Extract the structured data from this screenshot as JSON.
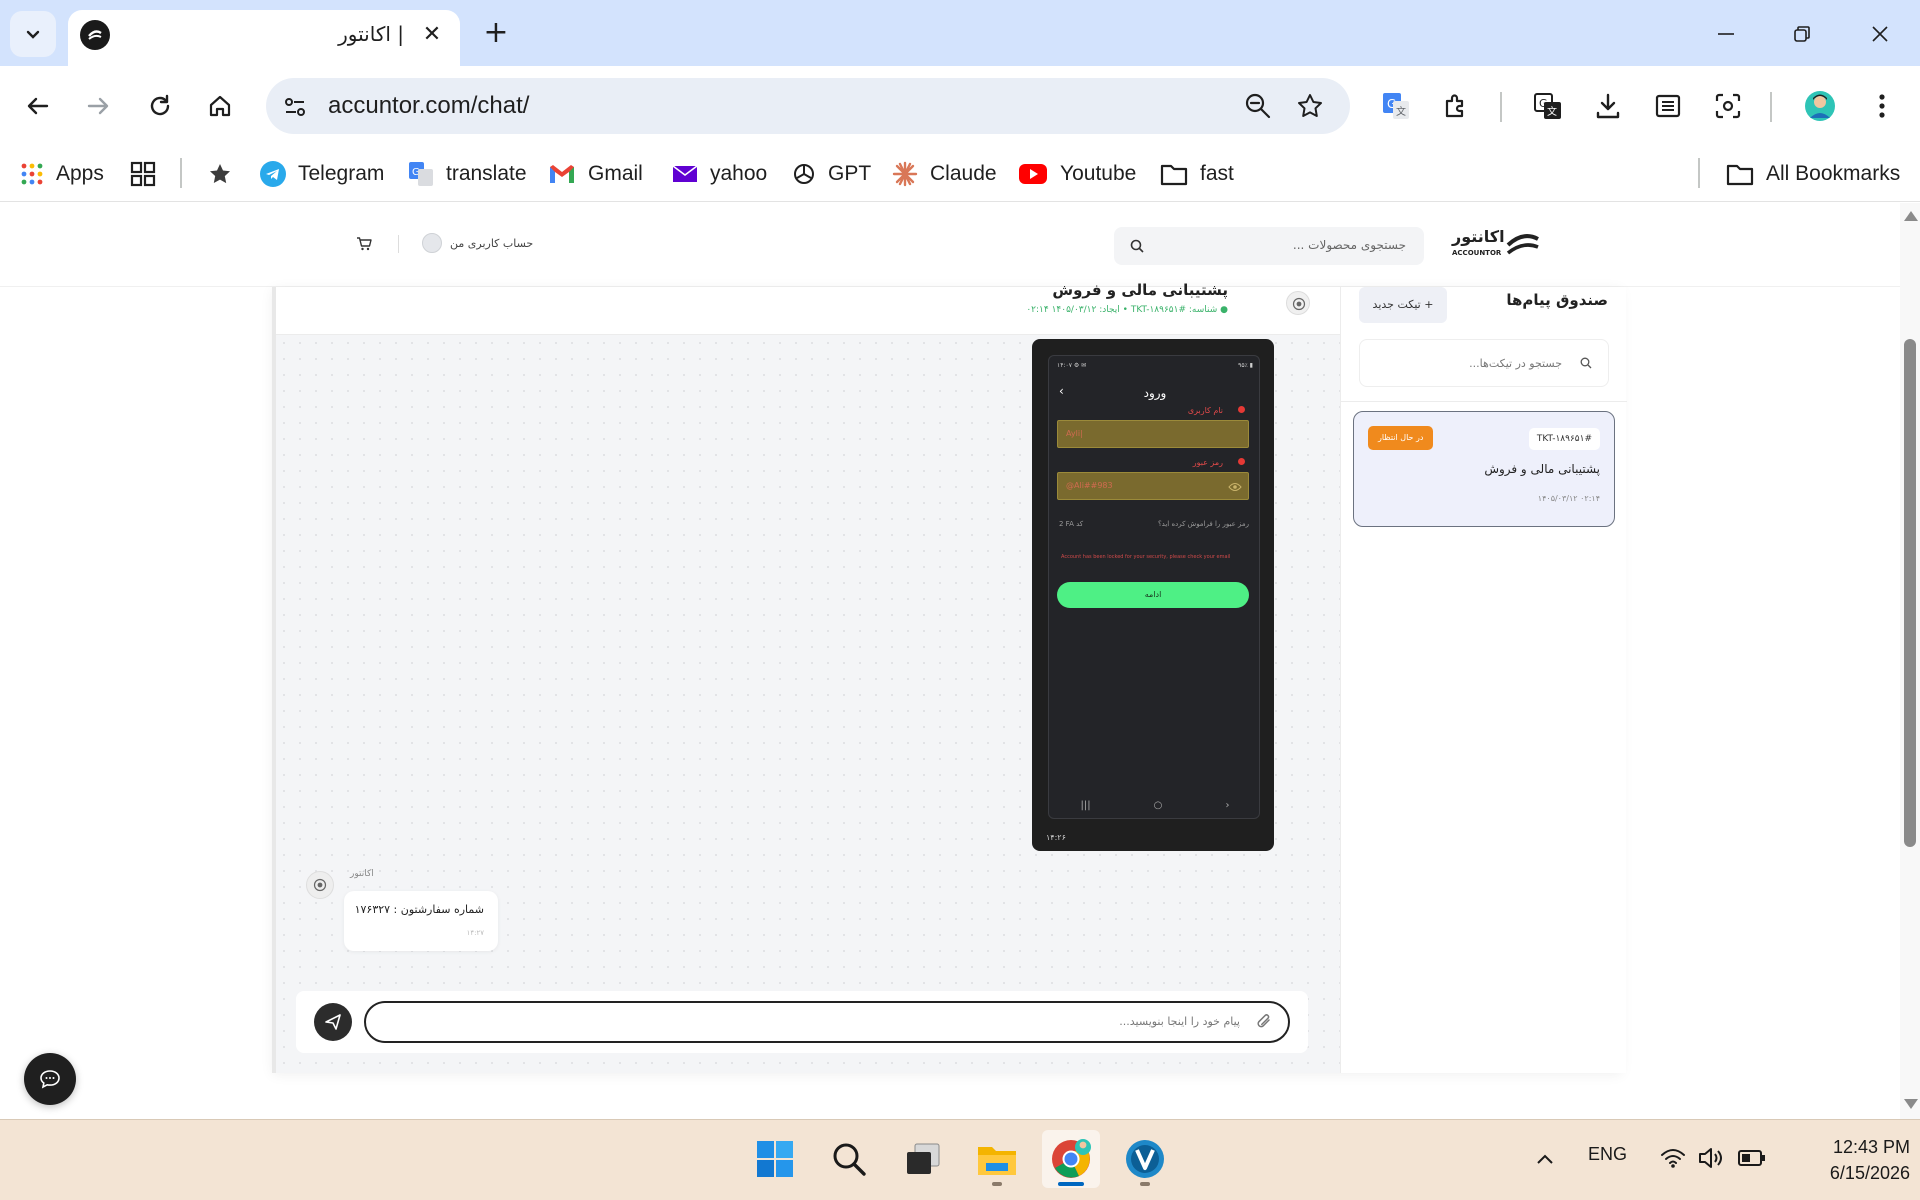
{
  "browser": {
    "tab_title": "| اکانتور",
    "url": "accuntor.com/chat/",
    "new_tab_symbol": "+",
    "close_symbol": "✕"
  },
  "bookmarks": {
    "items": [
      {
        "label": "Apps",
        "icon": "apps-grid-icon"
      },
      {
        "label": "",
        "icon": "tab-groups-icon"
      },
      {
        "label": "",
        "icon": "star-icon"
      },
      {
        "label": "Telegram",
        "icon": "telegram-icon"
      },
      {
        "label": "translate",
        "icon": "google-translate-icon"
      },
      {
        "label": "Gmail",
        "icon": "gmail-icon"
      },
      {
        "label": "yahoo",
        "icon": "yahoo-mail-icon"
      },
      {
        "label": "GPT",
        "icon": "openai-icon"
      },
      {
        "label": "Claude",
        "icon": "claude-icon"
      },
      {
        "label": "Youtube",
        "icon": "youtube-icon"
      },
      {
        "label": "fast",
        "icon": "folder-icon"
      }
    ],
    "all_bookmarks": "All Bookmarks"
  },
  "site": {
    "brand": "اکانتور",
    "brand_sub": "ACCOUNTOR",
    "search_placeholder": "جستجوی محصولات ...",
    "account_label": "حساب کاربری من"
  },
  "chat": {
    "title": "پشتیبانی مالی و فروش",
    "meta": "● شناسه: TKT-۱۸۹۶۵۱# • ایجاد: ۱۴۰۵/۰۳/۱۲ ۰۲:۱۴",
    "image_message": {
      "phone_status_left": "۱۴:۰۷ ⚙ ✉",
      "phone_status_right": "۹۵٪ ▮",
      "screen_title": "ورود",
      "username_label": "نام کاربری",
      "username_value": "Ayli|",
      "password_label": "رمز عبور",
      "password_value": "@Ali##983",
      "forgot_link": "رمز عبور را فراموش کرده اید؟",
      "twofa_label": "2 FA کد",
      "error_text": "Account has been locked for your security, please check your email",
      "continue_button": "ادامه",
      "time": "۱۴:۲۶"
    },
    "bot_sender": "اکانتور",
    "bot_message": "شماره سفارشتون : ۱۷۶۳۲۷",
    "bot_message_time": "۱۴:۲۷",
    "composer_placeholder": "پیام خود را اینجا بنویسید..."
  },
  "sidebar": {
    "title": "صندوق پیام‌ها",
    "new_ticket_label": "+ تیکت جدید",
    "search_placeholder": "جستجو در تیکت‌ها...",
    "tickets": [
      {
        "id": "TKT-۱۸۹۶۵۱#",
        "status": "در حال انتظار",
        "subject": "پشتیبانی مالی و فروش",
        "date": "۱۴۰۵/۰۳/۱۲ ۰۲:۱۴"
      }
    ]
  },
  "taskbar": {
    "language": "ENG",
    "time": "12:43 PM",
    "date": "6/15/2026"
  },
  "colors": {
    "titlebar": "#d3e3fd",
    "omnibox": "#e9eef6",
    "accent_green": "#4ef085",
    "status_orange": "#f08a1d",
    "taskbar": "#f3e4d4"
  }
}
